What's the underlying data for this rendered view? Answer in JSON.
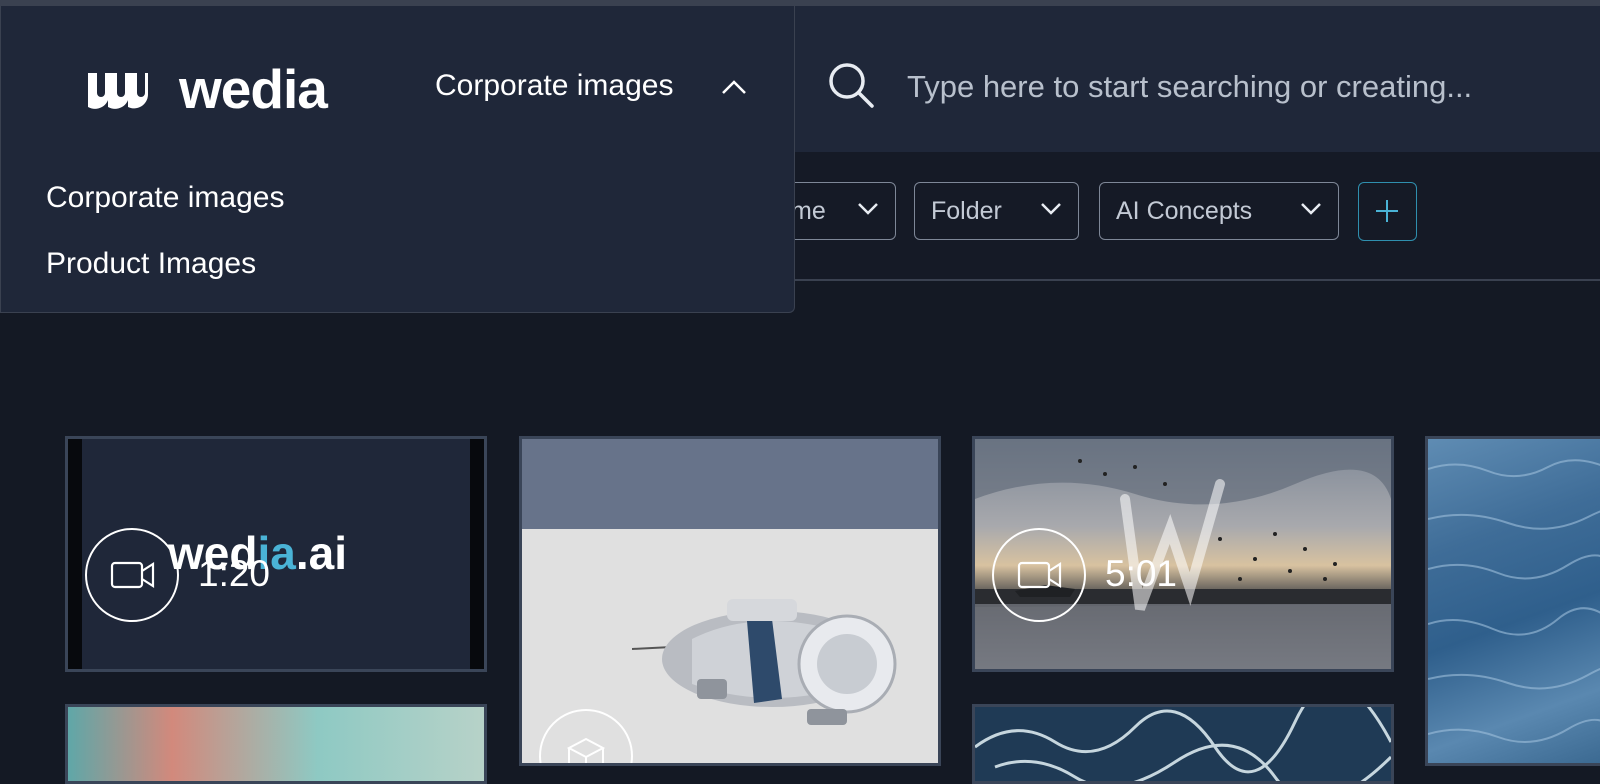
{
  "app": {
    "logo_text": "wedia"
  },
  "collection_selector": {
    "current": "Corporate images",
    "options": [
      "Corporate images",
      "Product Images"
    ]
  },
  "search": {
    "placeholder": "Type here to start searching or creating..."
  },
  "filters": [
    {
      "label": "me"
    },
    {
      "label": "Folder"
    },
    {
      "label": "AI Concepts"
    }
  ],
  "assets": [
    {
      "type": "video",
      "duration": "1:20",
      "thumbnail_text": "wedia.ai",
      "thumbnail_highlight": "ia"
    },
    {
      "type": "3d-model",
      "subject": "submarine"
    },
    {
      "type": "video",
      "duration": "5:01",
      "subject": "sunset-with-birds"
    },
    {
      "type": "image",
      "subject": "ocean-waves"
    },
    {
      "type": "image",
      "subject": "blurred-colors"
    },
    {
      "type": "image",
      "subject": "ocean-foam"
    }
  ],
  "colors": {
    "background": "#141924",
    "header": "#1f2739",
    "accent": "#2f8fae",
    "brand_teal": "#4ab3d6"
  }
}
